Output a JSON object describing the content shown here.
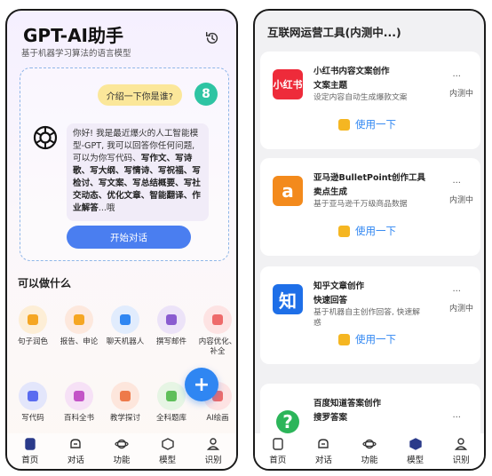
{
  "left": {
    "title": "GPT-AI助手",
    "subtitle": "基于机器学习算法的语言模型",
    "user_message": "介绍一下你是谁?",
    "user_avatar_letter": "8",
    "bot_message_parts": [
      "你好! 我是最近爆火的人工智能模型-GPT, 我可以回答你任何问题, 可以为你写代码、",
      "写作文、写诗歌、写大纲、写情诗、写祝福、写检讨、写文案、写总结概要、写社交动态、优化文章、智能翻译、作业解答",
      "...哦"
    ],
    "start_chat_label": "开始对话",
    "section_title": "可以做什么",
    "features_row1": [
      {
        "label": "句子润色",
        "icon": "pen-icon",
        "color": "#f5a623",
        "bg": "#fdeed6"
      },
      {
        "label": "报告、申论",
        "icon": "document-icon",
        "color": "#f5a623",
        "bg": "#fde8dd"
      },
      {
        "label": "聊天机器人",
        "icon": "chat-bubble-icon",
        "color": "#2f86f2",
        "bg": "#e1ecfd"
      },
      {
        "label": "撰写邮件",
        "icon": "mail-icon",
        "color": "#8a5cd0",
        "bg": "#ece3f8"
      },
      {
        "label": "内容优化、补全",
        "icon": "edit-icon",
        "color": "#ee6a6a",
        "bg": "#fde3e3"
      }
    ],
    "features_row2": [
      {
        "label": "写代码",
        "icon": "code-icon",
        "color": "#5a6cf0",
        "bg": "#e3e6fb"
      },
      {
        "label": "百科全书",
        "icon": "book-icon",
        "color": "#c354c7",
        "bg": "#f6e1f6"
      },
      {
        "label": "教学探讨",
        "icon": "lightbulb-icon",
        "color": "#ee7a4a",
        "bg": "#fde6dc"
      },
      {
        "label": "全科题库",
        "icon": "database-icon",
        "color": "#5fbf5a",
        "bg": "#e6f5e4"
      },
      {
        "label": "AI绘画",
        "icon": "palette-icon",
        "color": "#ee6a6a",
        "bg": "#fde3e3"
      }
    ],
    "fab_symbol": "+",
    "nav": [
      {
        "label": "首页",
        "icon": "home-icon"
      },
      {
        "label": "对话",
        "icon": "chat-icon"
      },
      {
        "label": "功能",
        "icon": "planet-icon"
      },
      {
        "label": "模型",
        "icon": "cube-icon"
      },
      {
        "label": "识别",
        "icon": "user-icon"
      }
    ]
  },
  "right": {
    "title": "互联网运营工具(内测中...)",
    "tools": [
      {
        "name": "小红书内容文案创作",
        "subname": "文案主题",
        "desc": "设定内容自动生成爆款文案",
        "status": "内测中",
        "more": "...",
        "use_label": "使用一下",
        "logo_text": "小红书",
        "logo_color": "#ee2b3a",
        "icon": "xiaohongshu-logo"
      },
      {
        "name": "亚马逊BulletPoint创作工具",
        "subname": "卖点生成",
        "desc": "基于亚马逊千万级商品数据",
        "status": "内测中",
        "more": "...",
        "use_label": "使用一下",
        "logo_text": "a",
        "logo_color": "#f38a1c",
        "icon": "amazon-logo"
      },
      {
        "name": "知乎文章创作",
        "subname": "快速回答",
        "desc": "基于机器自主创作回答, 快速解惑",
        "status": "内测中",
        "more": "...",
        "use_label": "使用一下",
        "logo_text": "知",
        "logo_color": "#1e6fe8",
        "icon": "zhihu-logo"
      },
      {
        "name": "百度知道答案创作",
        "subname": "搜罗答案",
        "desc": "",
        "status": "",
        "more": "...",
        "use_label": "",
        "logo_text": "?",
        "logo_color": "#2cb55a",
        "icon": "baidu-zhidao-logo"
      }
    ],
    "nav": [
      {
        "label": "首页",
        "icon": "home-icon"
      },
      {
        "label": "对话",
        "icon": "chat-icon"
      },
      {
        "label": "功能",
        "icon": "planet-icon"
      },
      {
        "label": "模型",
        "icon": "cube-icon"
      },
      {
        "label": "识别",
        "icon": "user-icon"
      }
    ]
  }
}
